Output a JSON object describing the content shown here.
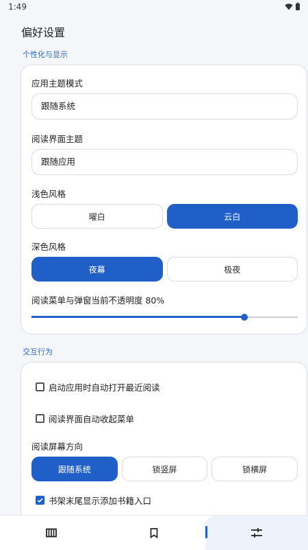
{
  "status": {
    "time": "1:49"
  },
  "page": {
    "title": "偏好设置"
  },
  "sections": {
    "display": {
      "title": "个性化与显示",
      "app_theme": {
        "label": "应用主题模式",
        "value": "跟随系统"
      },
      "reader_theme": {
        "label": "阅读界面主题",
        "value": "跟随应用"
      },
      "light_style": {
        "label": "浅色风格",
        "options": [
          "曜白",
          "云白"
        ],
        "selected": 1
      },
      "dark_style": {
        "label": "深色风格",
        "options": [
          "夜幕",
          "极夜"
        ],
        "selected": 0
      },
      "opacity": {
        "label": "阅读菜单与弹窗当前不透明度 80%",
        "value": 0.8
      }
    },
    "interaction": {
      "title": "交互行为",
      "auto_open_recent": {
        "label": "启动应用时自动打开最近阅读",
        "checked": false
      },
      "auto_collapse_menu": {
        "label": "阅读界面自动收起菜单",
        "checked": false
      },
      "orientation": {
        "label": "阅读屏幕方向",
        "options": [
          "跟随系统",
          "锁竖屏",
          "锁横屏"
        ],
        "selected": 0
      },
      "show_add_book": {
        "label": "书架末尾显示添加书籍入口",
        "checked": true
      }
    }
  },
  "nav": {
    "items": [
      {
        "icon": "bookshelf-icon"
      },
      {
        "icon": "bookmark-icon"
      },
      {
        "icon": "settings-sliders-icon",
        "active": true
      }
    ]
  },
  "colors": {
    "accent": "#1f5fc7",
    "section_title": "#2b67c8",
    "background": "#f4f6fa"
  }
}
